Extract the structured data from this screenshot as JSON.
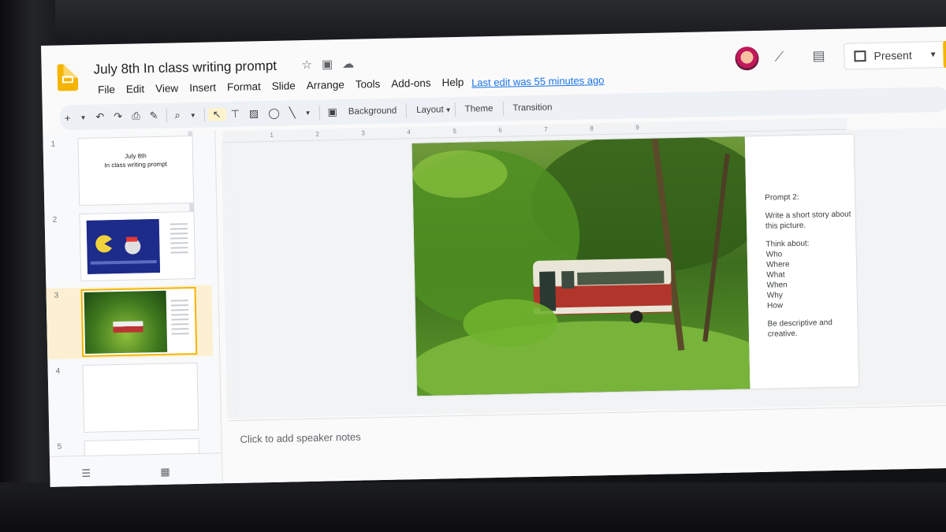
{
  "app": {
    "doc_title": "July 8th  In class writing prompt",
    "last_edit": "Last edit was 55 minutes ago",
    "present_label": "Present"
  },
  "menu": [
    "File",
    "Edit",
    "View",
    "Insert",
    "Format",
    "Slide",
    "Arrange",
    "Tools",
    "Add-ons",
    "Help"
  ],
  "toolbar": {
    "background": "Background",
    "layout": "Layout",
    "theme": "Theme",
    "transition": "Transition"
  },
  "ruler_ticks": [
    "1",
    "2",
    "3",
    "4",
    "5",
    "6",
    "7",
    "8",
    "9"
  ],
  "slides": [
    {
      "number": "1",
      "title_line1": "July 8th",
      "title_line2": "In class writing prompt"
    },
    {
      "number": "2"
    },
    {
      "number": "3",
      "selected": true
    },
    {
      "number": "4"
    },
    {
      "number": "5"
    }
  ],
  "current_slide": {
    "prompt_title": "Prompt 2:",
    "prompt_body": "Write a short story about this picture.",
    "think_about": "Think about:",
    "questions": [
      "Who",
      "Where",
      "What",
      "When",
      "Why",
      "How"
    ],
    "closing": "Be descriptive and creative."
  },
  "speaker_notes_placeholder": "Click to add speaker notes",
  "colors": {
    "brand": "#f4b400",
    "link": "#1a73e8",
    "toolbar_bg": "#edf1f5",
    "selected_thumb_bg": "#fdf0d2"
  }
}
